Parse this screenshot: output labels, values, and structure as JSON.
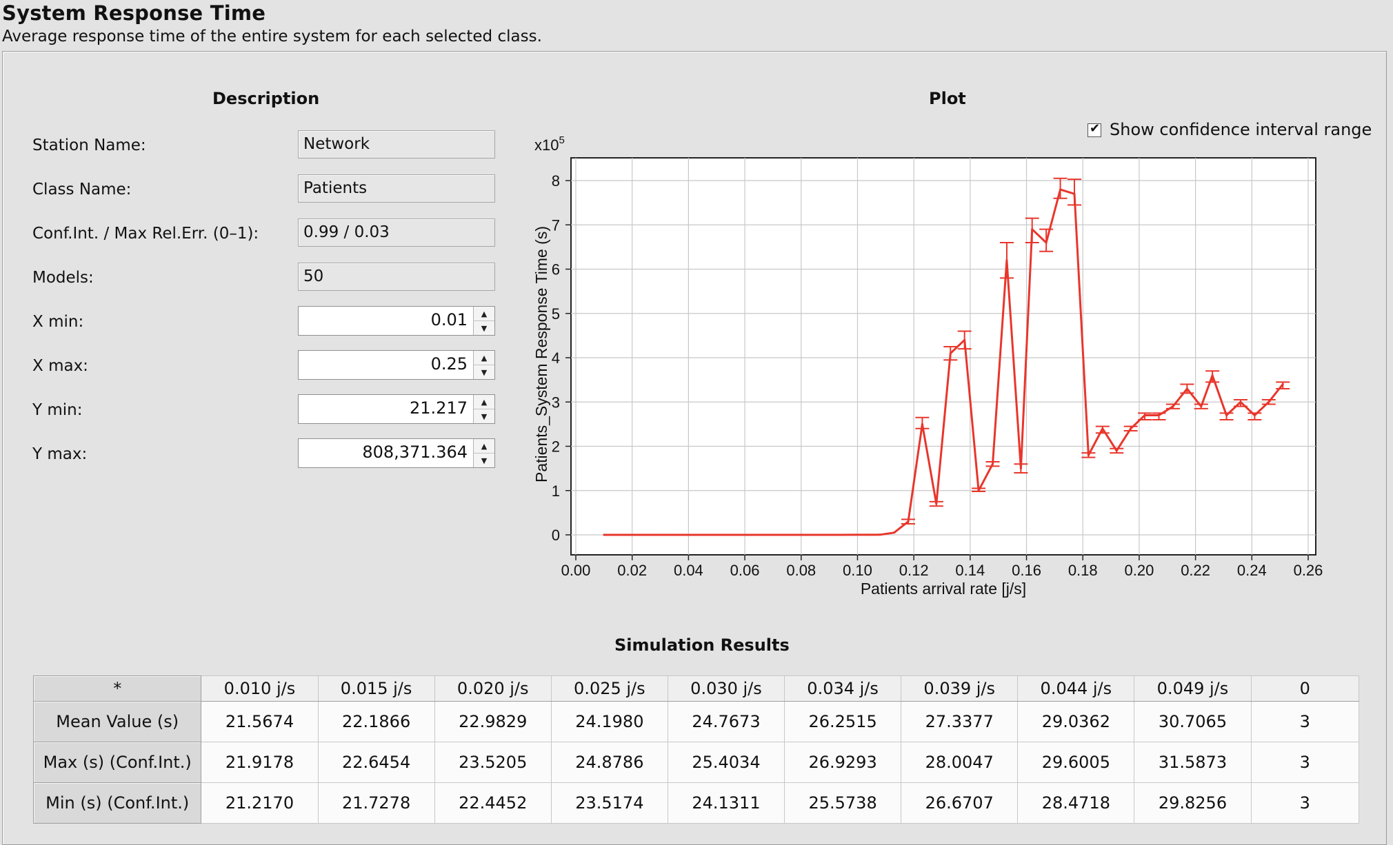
{
  "header": {
    "title": "System Response Time",
    "subtitle": "Average response time of the entire system for each selected class."
  },
  "description": {
    "title": "Description",
    "station_name_label": "Station Name:",
    "station_name": "Network",
    "class_name_label": "Class Name:",
    "class_name": "Patients",
    "conf_label": "Conf.Int. / Max Rel.Err. (0–1):",
    "conf_value": "0.99 / 0.03",
    "models_label": "Models:",
    "models_value": "50",
    "xmin_label": "X min:",
    "xmin_value": "0.01",
    "xmax_label": "X max:",
    "xmax_value": "0.25",
    "ymin_label": "Y min:",
    "ymin_value": "21.217",
    "ymax_label": "Y max:",
    "ymax_value": "808,371.364"
  },
  "plot": {
    "title": "Plot",
    "show_ci_label": "Show confidence interval range",
    "show_ci_checked": true,
    "y_multiplier_base": "x10",
    "y_multiplier_exp": "5"
  },
  "chart_data": {
    "type": "line",
    "xlabel": "Patients arrival rate [j/s]",
    "ylabel": "Patients_System Response Time (s)",
    "xlim": [
      0.0,
      0.26
    ],
    "ylim": [
      0,
      8
    ],
    "y_scale_note": "x10^5",
    "x_ticks": [
      "0.00",
      "0.02",
      "0.04",
      "0.06",
      "0.08",
      "0.10",
      "0.12",
      "0.14",
      "0.16",
      "0.18",
      "0.20",
      "0.22",
      "0.24",
      "0.26"
    ],
    "y_ticks": [
      "0",
      "1",
      "2",
      "3",
      "4",
      "5",
      "6",
      "7",
      "8"
    ],
    "grid": true,
    "series_color": "#e8362b",
    "series": [
      {
        "x": [
          0.01,
          0.015,
          0.02,
          0.025,
          0.03,
          0.034,
          0.039,
          0.044,
          0.049,
          0.054,
          0.059,
          0.064,
          0.069,
          0.074,
          0.079,
          0.084,
          0.089,
          0.094,
          0.099,
          0.104,
          0.108,
          0.113,
          0.118,
          0.123,
          0.128,
          0.133,
          0.138,
          0.143,
          0.148,
          0.153,
          0.158,
          0.162,
          0.167,
          0.172,
          0.177,
          0.182,
          0.187,
          0.192,
          0.197,
          0.202,
          0.207,
          0.212,
          0.217,
          0.222,
          0.226,
          0.231,
          0.236,
          0.241,
          0.246,
          0.251
        ],
        "y": [
          0.000216,
          0.000222,
          0.00023,
          0.000242,
          0.000248,
          0.000263,
          0.000273,
          0.00029,
          0.000307,
          0.00032,
          0.00034,
          0.00036,
          0.00038,
          0.0004,
          0.00043,
          0.00046,
          0.0005,
          0.0006,
          0.0008,
          0.0012,
          0.003,
          0.05,
          0.3,
          2.5,
          0.7,
          4.1,
          4.4,
          1.0,
          1.6,
          6.2,
          1.5,
          6.9,
          6.6,
          7.8,
          7.7,
          1.8,
          2.4,
          1.9,
          2.4,
          2.7,
          2.7,
          2.9,
          3.3,
          2.9,
          3.6,
          2.7,
          3.0,
          2.7,
          3.0,
          3.4
        ],
        "ci_low": [
          null,
          null,
          null,
          null,
          null,
          null,
          null,
          null,
          null,
          null,
          null,
          null,
          null,
          null,
          null,
          null,
          null,
          null,
          null,
          null,
          null,
          null,
          0.25,
          2.4,
          0.65,
          3.95,
          4.2,
          0.98,
          1.55,
          5.8,
          1.4,
          6.6,
          6.4,
          7.6,
          7.45,
          1.75,
          2.3,
          1.85,
          2.35,
          2.6,
          2.6,
          2.85,
          3.2,
          2.85,
          3.45,
          2.6,
          2.9,
          2.6,
          2.95,
          3.3
        ],
        "ci_high": [
          null,
          null,
          null,
          null,
          null,
          null,
          null,
          null,
          null,
          null,
          null,
          null,
          null,
          null,
          null,
          null,
          null,
          null,
          null,
          null,
          null,
          null,
          0.35,
          2.65,
          0.75,
          4.25,
          4.6,
          1.05,
          1.65,
          6.6,
          1.6,
          7.15,
          6.9,
          8.05,
          8.03,
          1.85,
          2.45,
          1.95,
          2.45,
          2.75,
          2.75,
          2.95,
          3.4,
          2.95,
          3.7,
          2.75,
          3.05,
          2.75,
          3.05,
          3.45
        ]
      }
    ]
  },
  "results": {
    "title": "Simulation Results",
    "corner": "*",
    "columns": [
      "0.010 j/s",
      "0.015 j/s",
      "0.020 j/s",
      "0.025 j/s",
      "0.030 j/s",
      "0.034 j/s",
      "0.039 j/s",
      "0.044 j/s",
      "0.049 j/s",
      "0"
    ],
    "rows": [
      {
        "label": "Mean Value (s)",
        "cells": [
          "21.5674",
          "22.1866",
          "22.9829",
          "24.1980",
          "24.7673",
          "26.2515",
          "27.3377",
          "29.0362",
          "30.7065",
          "3"
        ]
      },
      {
        "label": "Max (s) (Conf.Int.)",
        "cells": [
          "21.9178",
          "22.6454",
          "23.5205",
          "24.8786",
          "25.4034",
          "26.9293",
          "28.0047",
          "29.6005",
          "31.5873",
          "3"
        ]
      },
      {
        "label": "Min (s) (Conf.Int.)",
        "cells": [
          "21.2170",
          "21.7278",
          "22.4452",
          "23.5174",
          "24.1311",
          "25.5738",
          "26.6707",
          "28.4718",
          "29.8256",
          "3"
        ]
      }
    ]
  }
}
